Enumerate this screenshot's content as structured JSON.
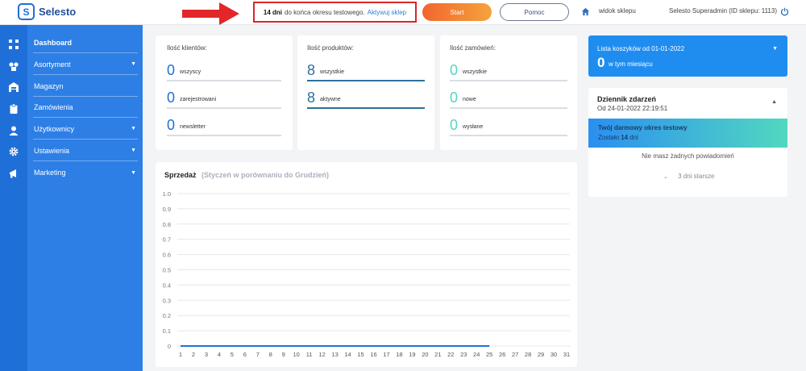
{
  "header": {
    "logo_mark": "S",
    "logo_text": "Selesto",
    "trial_days": "14 dni",
    "trial_text": "do końca okresu testowego.",
    "trial_link": "Aktywuj sklep",
    "start_label": "Start",
    "help_label": "Pomoc",
    "shop_view_label": "widok sklepu",
    "admin_label": "Selesto Superadmin (ID sklepu: 1113)",
    "accent_color": "#1f6fd8",
    "start_color": "#f3652f"
  },
  "sidebar": {
    "items": [
      {
        "label": "Dashboard",
        "icon": "grid-icon",
        "has_caret": false,
        "active": true
      },
      {
        "label": "Asortyment",
        "icon": "boxes-icon",
        "has_caret": true
      },
      {
        "label": "Magazyn",
        "icon": "warehouse-icon",
        "has_caret": false
      },
      {
        "label": "Zamówienia",
        "icon": "clipboard-icon",
        "has_caret": false
      },
      {
        "label": "Użytkownicy",
        "icon": "user-icon",
        "has_caret": true
      },
      {
        "label": "Ustawienia",
        "icon": "gear-icon",
        "has_caret": true
      },
      {
        "label": "Marketing",
        "icon": "megaphone-icon",
        "has_caret": true
      }
    ],
    "caret": "▼"
  },
  "stats": {
    "clients": {
      "title": "Ilość klientów:",
      "rows": [
        {
          "value": "0",
          "label": "wszyscy"
        },
        {
          "value": "0",
          "label": "zarejestrowani"
        },
        {
          "value": "0",
          "label": "newsletter"
        }
      ]
    },
    "products": {
      "title": "Ilość produktów:",
      "rows": [
        {
          "value": "8",
          "label": "wszystkie"
        },
        {
          "value": "8",
          "label": "aktywne"
        }
      ]
    },
    "orders": {
      "title": "Ilość zamówień:",
      "rows": [
        {
          "value": "0",
          "label": "wszystkie"
        },
        {
          "value": "0",
          "label": "nowe"
        },
        {
          "value": "0",
          "label": "wysłane"
        }
      ]
    }
  },
  "sales": {
    "title": "Sprzedaż",
    "subtitle": "(Styczeń w porównaniu do Grudzień)"
  },
  "chart_data": {
    "type": "line",
    "title": "Sprzedaż",
    "subtitle": "(Styczeń w porównaniu do Grudzień)",
    "x": [
      1,
      2,
      3,
      4,
      5,
      6,
      7,
      8,
      9,
      10,
      11,
      12,
      13,
      14,
      15,
      16,
      17,
      18,
      19,
      20,
      21,
      22,
      23,
      24,
      25,
      26,
      27,
      28,
      29,
      30,
      31
    ],
    "y_ticks": [
      "1.0",
      "0.9",
      "0.8",
      "0.7",
      "0.6",
      "0.5",
      "0.4",
      "0.3",
      "0.2",
      "0.1",
      "0"
    ],
    "ylim": [
      0,
      1
    ],
    "grid": true,
    "series": [
      {
        "values": [
          0,
          0,
          0,
          0,
          0,
          0,
          0,
          0,
          0,
          0,
          0,
          0,
          0,
          0,
          0,
          0,
          0,
          0,
          0,
          0,
          0,
          0,
          0,
          0,
          0
        ],
        "color": "#1f6fd8"
      }
    ]
  },
  "basket": {
    "title": "Lista koszyków od 01-01-2022",
    "caret": "▼",
    "value": "0",
    "sub": "w tym miesiącu"
  },
  "events": {
    "title": "Dziennik zdarzeń",
    "date": "Od 24-01-2022 22:19:51",
    "caret": "▲",
    "banner_title": "Twój darmowy okres testowy",
    "banner_prefix": "Zostało",
    "banner_days": "14",
    "banner_suffix": "dni",
    "no_notifications": "Nie masz żadnych powiadomień",
    "older_chevron": "⌄",
    "older_label": "3 dni starsze"
  }
}
